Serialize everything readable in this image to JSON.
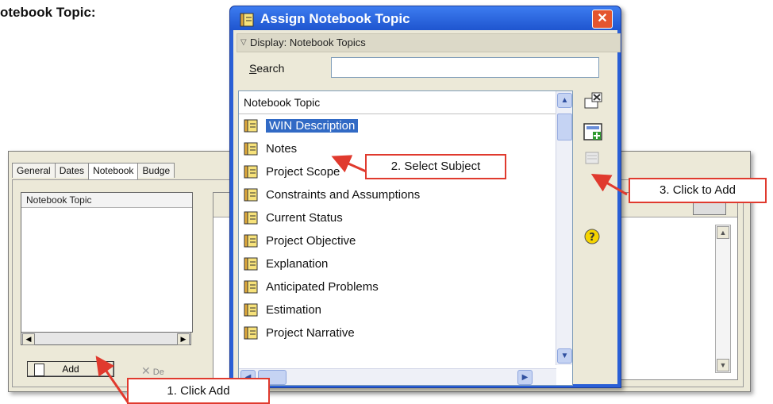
{
  "heading": "otebook Topic:",
  "background_window": {
    "tabs": [
      "General",
      "Dates",
      "Notebook",
      "Budge"
    ],
    "active_tab": "Notebook",
    "list_header": "Notebook Topic",
    "add_button_label": "Add",
    "delete_button_label": "De"
  },
  "dialog": {
    "title": "Assign Notebook Topic",
    "close_label": "✕",
    "display_label": "Display: Notebook Topics",
    "search_label_underlined": "S",
    "search_label_rest": "earch",
    "search_value": "",
    "list_header": "Notebook Topic",
    "topics": [
      "WIN Description",
      "Notes",
      "Project Scope",
      "Constraints and Assumptions",
      "Current Status",
      "Project Objective",
      "Explanation",
      "Anticipated Problems",
      "Estimation",
      "Project Narrative"
    ],
    "selected_index": 0
  },
  "callouts": {
    "step1": "1. Click Add",
    "step2": "2. Select Subject",
    "step3": "3. Click to Add"
  },
  "colors": {
    "titlebar": "#2a5fd6",
    "selection": "#316ac5",
    "callout_border": "#e03a2e",
    "window_bg": "#ece9d8"
  }
}
